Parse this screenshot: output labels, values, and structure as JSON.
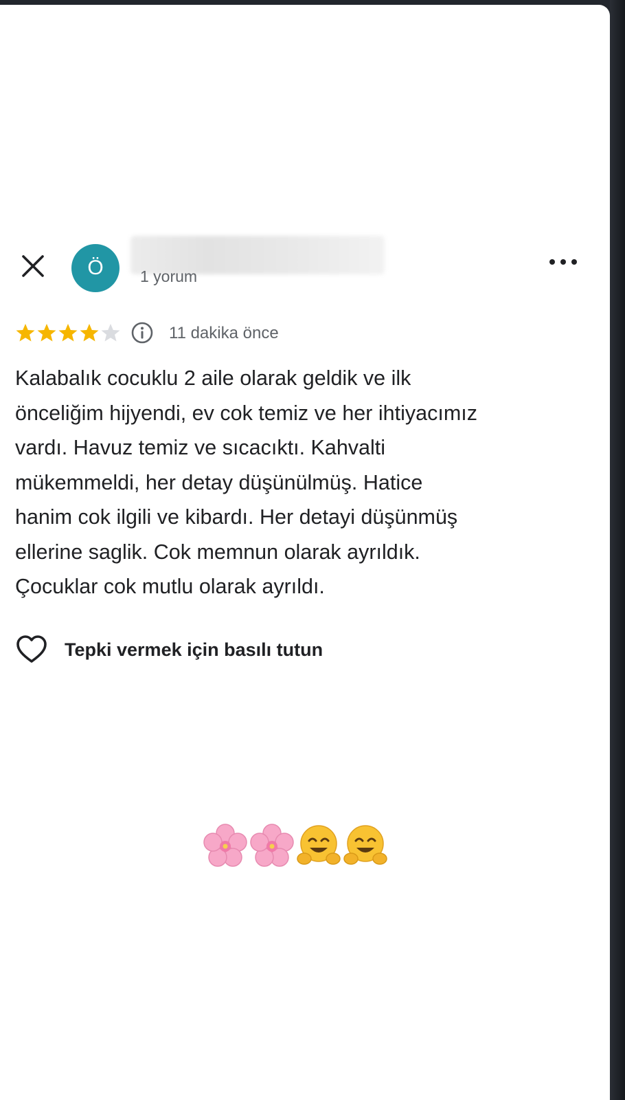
{
  "header": {
    "avatar_letter": "Ö",
    "avatar_color": "#2196a5",
    "review_count": "1 yorum"
  },
  "rating": {
    "stars": 4,
    "max_stars": 5,
    "star_color": "#f6b600",
    "time": "11 dakika önce"
  },
  "review": {
    "text": "Kalabalık cocuklu 2 aile olarak geldik ve ilk\nönceliğim hijyendi, ev cok temiz ve her ihtiyacımız\nvardı. Havuz temiz ve sıcacıktı. Kahvalti\nmükemmeldi, her detay düşünülmüş. Hatice\nhanim cok ilgili ve kibardı. Her detayi düşünmüş\nellerine saglik. Cok memnun olarak ayrıldık.\nÇocuklar cok mutlu olarak ayrıldı."
  },
  "reaction": {
    "label": "Tepki vermek için basılı tutun"
  },
  "caption": {
    "emojis": [
      "cherry-blossom",
      "cherry-blossom",
      "hugging-face",
      "hugging-face"
    ]
  }
}
